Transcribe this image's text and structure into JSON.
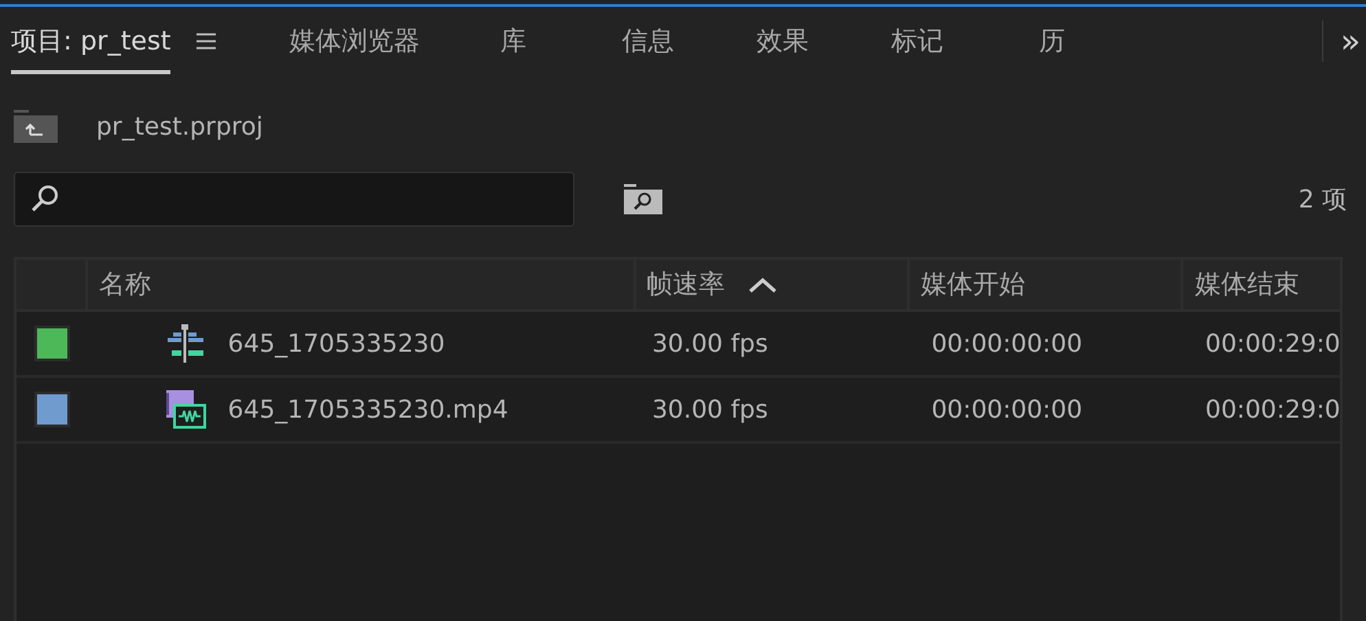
{
  "tabs": [
    {
      "label": "项目: pr_test",
      "selected": true,
      "menu": true
    },
    {
      "label": "媒体浏览器",
      "selected": false
    },
    {
      "label": "库",
      "selected": false
    },
    {
      "label": "信息",
      "selected": false
    },
    {
      "label": "效果",
      "selected": false
    },
    {
      "label": "标记",
      "selected": false
    },
    {
      "label": "历",
      "selected": false
    }
  ],
  "overflow_glyph": "»",
  "project_file": "pr_test.prproj",
  "item_count": "2 项",
  "table": {
    "columns": [
      {
        "label": "名称",
        "sorted": false
      },
      {
        "label": "帧速率",
        "sorted": true
      },
      {
        "label": "媒体开始",
        "sorted": false
      },
      {
        "label": "媒体结束",
        "sorted": false
      }
    ],
    "rows": [
      {
        "color": "#4cb858",
        "kind": "sequence",
        "name": "645_1705335230",
        "fps": "30.00 fps",
        "start": "00:00:00:00",
        "end": "00:00:29:0"
      },
      {
        "color": "#6f9bcf",
        "kind": "clip",
        "name": "645_1705335230.mp4",
        "fps": "30.00 fps",
        "start": "00:00:00:00",
        "end": "00:00:29:0"
      }
    ]
  }
}
